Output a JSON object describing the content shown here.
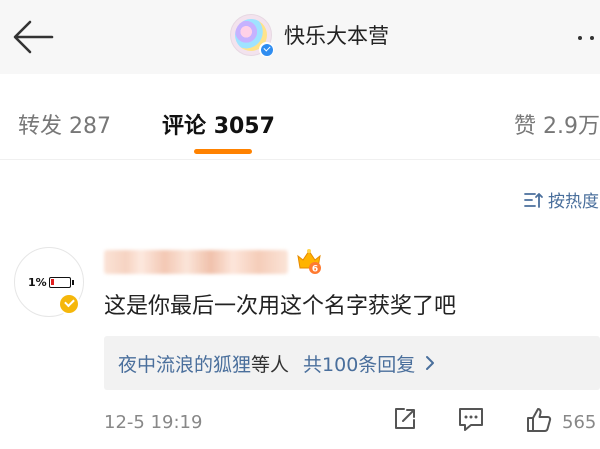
{
  "header": {
    "account_name": "快乐大本营"
  },
  "tabs": [
    {
      "label": "转发",
      "count": "287"
    },
    {
      "label": "评论",
      "count": "3057"
    },
    {
      "label": "赞",
      "count": "2.9万"
    }
  ],
  "sort": {
    "label": "按热度"
  },
  "comment": {
    "avatar_battery_text": "1%",
    "level": "6",
    "text": "这是你最后一次用这个名字获奖了吧",
    "replies": {
      "first_replier": "夜中流浪的狐狸",
      "suffix": "等人",
      "count_text": "共100条回复"
    },
    "time": "12-5 19:19",
    "like_count": "565"
  },
  "colors": {
    "accent": "#ff8200",
    "link": "#4a6f9c",
    "verified_blue": "#2f8df0",
    "verified_gold": "#f5b70b"
  }
}
